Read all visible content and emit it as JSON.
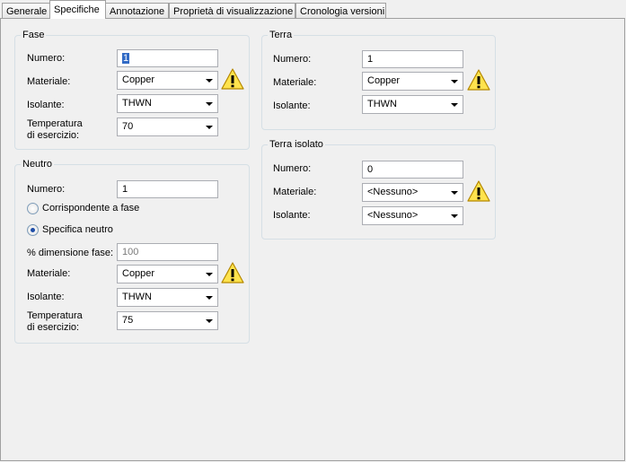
{
  "tabs": [
    "Generale",
    "Specifiche",
    "Annotazione",
    "Proprietà di visualizzazione",
    "Cronologia versioni"
  ],
  "fase": {
    "title": "Fase",
    "numero_label": "Numero:",
    "numero_value": "1",
    "materiale_label": "Materiale:",
    "materiale_value": "Copper",
    "isolante_label": "Isolante:",
    "isolante_value": "THWN",
    "temp_label_1": "Temperatura",
    "temp_label_2": "di esercizio:",
    "temp_value": "70"
  },
  "neutro": {
    "title": "Neutro",
    "numero_label": "Numero:",
    "numero_value": "1",
    "radio_corrispondente": "Corrispondente a fase",
    "radio_specifica": "Specifica neutro",
    "dimensione_label": "% dimensione fase:",
    "dimensione_value": "100",
    "materiale_label": "Materiale:",
    "materiale_value": "Copper",
    "isolante_label": "Isolante:",
    "isolante_value": "THWN",
    "temp_label_1": "Temperatura",
    "temp_label_2": "di esercizio:",
    "temp_value": "75"
  },
  "terra": {
    "title": "Terra",
    "numero_label": "Numero:",
    "numero_value": "1",
    "materiale_label": "Materiale:",
    "materiale_value": "Copper",
    "isolante_label": "Isolante:",
    "isolante_value": "THWN"
  },
  "terra_isolato": {
    "title": "Terra isolato",
    "numero_label": "Numero:",
    "numero_value": "0",
    "materiale_label": "Materiale:",
    "materiale_value": "<Nessuno>",
    "isolante_label": "Isolante:",
    "isolante_value": "<Nessuno>"
  },
  "icons": {
    "warning": "warning-triangle-icon"
  },
  "colors": {
    "warning_fill": "#ffe34d",
    "warning_stroke": "#b58800",
    "selection": "#316ac5"
  }
}
